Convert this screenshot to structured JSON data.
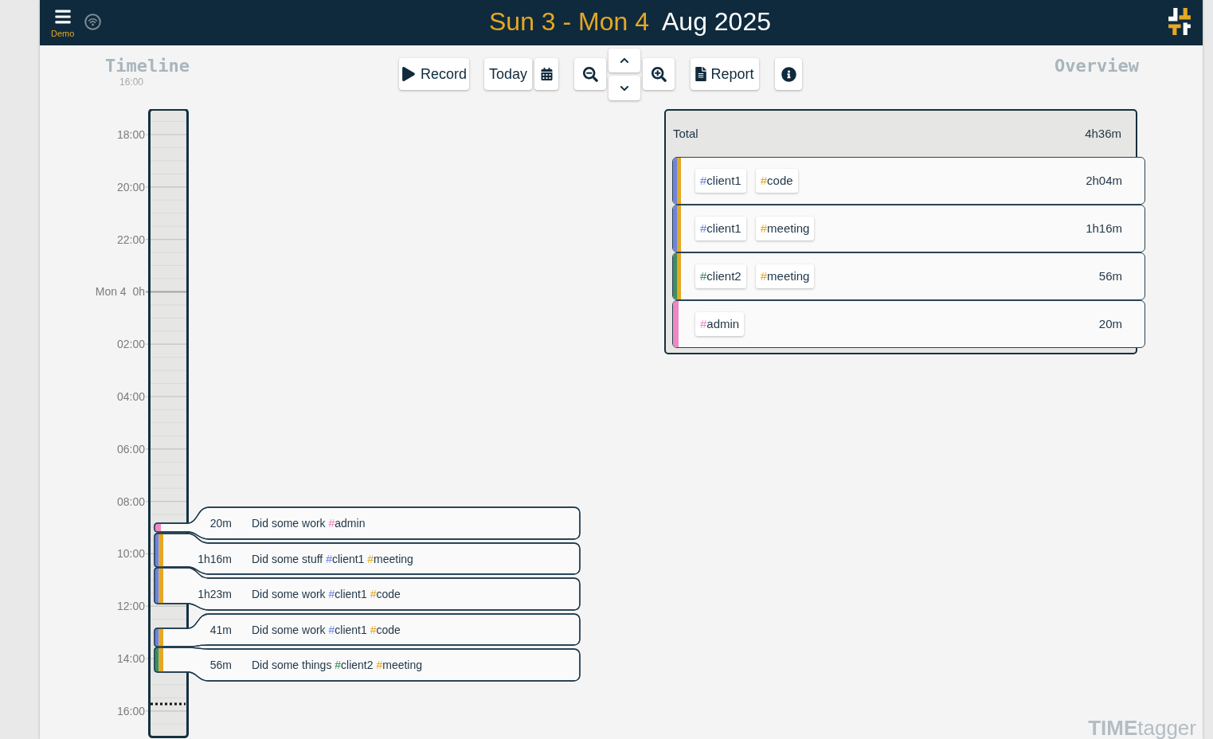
{
  "header": {
    "menu_label": "Demo",
    "date_range": "Sun 3 - Mon 4",
    "month": "Aug 2025"
  },
  "toolbar": {
    "record_label": "Record",
    "today_label": "Today",
    "report_label": "Report"
  },
  "timeline": {
    "title": "Timeline",
    "faded_tick": "16:00",
    "ticks": [
      "18:00",
      "20:00",
      "22:00",
      "Mon 4  0h",
      "02:00",
      "04:00",
      "06:00",
      "08:00",
      "10:00",
      "12:00",
      "14:00",
      "16:00"
    ]
  },
  "records": [
    {
      "duration": "20m",
      "text": "Did some work",
      "tags": [
        {
          "symbol": "#",
          "name": "admin",
          "color": "#ee88c4"
        }
      ]
    },
    {
      "duration": "1h16m",
      "text": "Did some stuff",
      "tags": [
        {
          "symbol": "#",
          "name": "client1",
          "color": "#6d84e0"
        },
        {
          "symbol": "#",
          "name": "meeting",
          "color": "#e5a823"
        }
      ]
    },
    {
      "duration": "1h23m",
      "text": "Did some work",
      "tags": [
        {
          "symbol": "#",
          "name": "client1",
          "color": "#6d84e0"
        },
        {
          "symbol": "#",
          "name": "code",
          "color": "#e5a823"
        }
      ]
    },
    {
      "duration": "41m",
      "text": "Did some work",
      "tags": [
        {
          "symbol": "#",
          "name": "client1",
          "color": "#6d84e0"
        },
        {
          "symbol": "#",
          "name": "code",
          "color": "#e5a823"
        }
      ]
    },
    {
      "duration": "56m",
      "text": "Did some things",
      "tags": [
        {
          "symbol": "#",
          "name": "client2",
          "color": "#3e8e5e"
        },
        {
          "symbol": "#",
          "name": "meeting",
          "color": "#e5a823"
        }
      ]
    }
  ],
  "overview": {
    "title": "Overview",
    "total": {
      "label": "Total",
      "duration": "4h36m"
    },
    "rows": [
      {
        "tags": [
          {
            "symbol": "#",
            "name": "client1",
            "color": "#6d84e0"
          },
          {
            "symbol": "#",
            "name": "code",
            "color": "#e5a823"
          }
        ],
        "duration": "2h04m"
      },
      {
        "tags": [
          {
            "symbol": "#",
            "name": "client1",
            "color": "#6d84e0"
          },
          {
            "symbol": "#",
            "name": "meeting",
            "color": "#e5a823"
          }
        ],
        "duration": "1h16m"
      },
      {
        "tags": [
          {
            "symbol": "#",
            "name": "client2",
            "color": "#3e8e5e"
          },
          {
            "symbol": "#",
            "name": "meeting",
            "color": "#e5a823"
          }
        ],
        "duration": "56m"
      },
      {
        "tags": [
          {
            "symbol": "#",
            "name": "admin",
            "color": "#ee88c4"
          }
        ],
        "duration": "20m"
      }
    ]
  },
  "brand": {
    "strong": "TIME",
    "light": "tagger"
  }
}
